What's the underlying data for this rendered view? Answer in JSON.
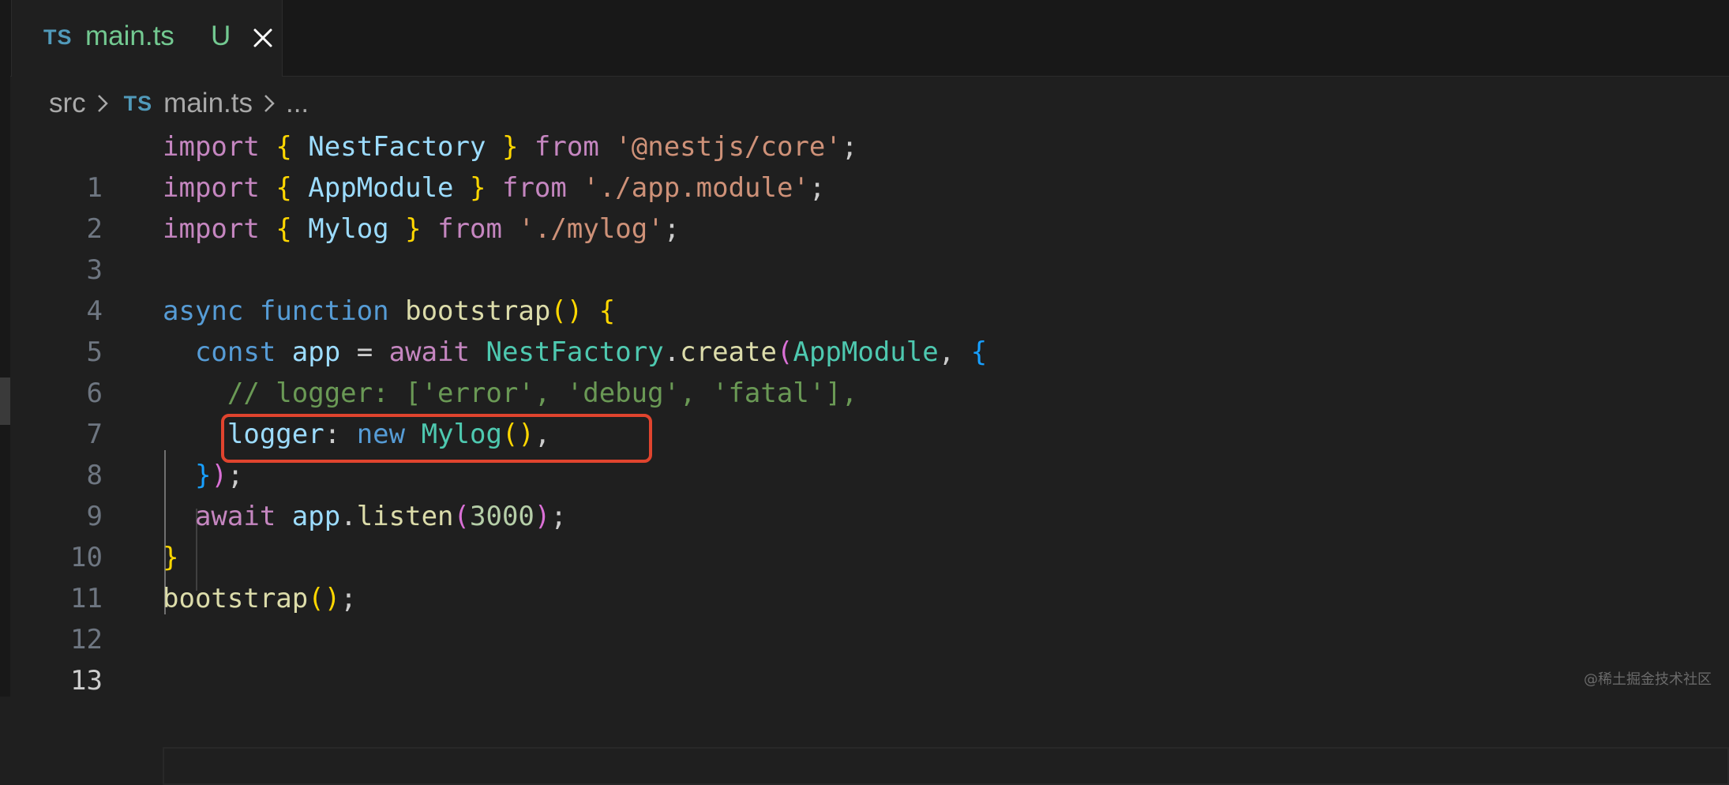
{
  "tab": {
    "file_type": "TS",
    "label": "main.ts",
    "status": "U"
  },
  "breadcrumb": {
    "folder": "src",
    "file_type": "TS",
    "file": "main.ts",
    "more": "..."
  },
  "editor": {
    "active_line": 13,
    "lines": [
      {
        "n": "1"
      },
      {
        "n": "2"
      },
      {
        "n": "3"
      },
      {
        "n": "4"
      },
      {
        "n": "5"
      },
      {
        "n": "6"
      },
      {
        "n": "7"
      },
      {
        "n": "8"
      },
      {
        "n": "9"
      },
      {
        "n": "10"
      },
      {
        "n": "11"
      },
      {
        "n": "12"
      },
      {
        "n": "13"
      }
    ],
    "tokens": {
      "import": "import",
      "from": "from",
      "nestfactory": "NestFactory",
      "appmodule": "AppModule",
      "mylog": "Mylog",
      "str_core": "'@nestjs/core'",
      "str_app_module": "'./app.module'",
      "str_mylog": "'./mylog'",
      "async": "async",
      "function": "function",
      "bootstrap": "bootstrap",
      "const": "const",
      "app": "app",
      "await": "await",
      "create": "create",
      "comment": "// logger: ['error', 'debug', 'fatal'],",
      "logger": "logger",
      "new": "new",
      "listen": "listen",
      "port": "3000"
    }
  },
  "watermark": "@稀土掘金技术社区",
  "colors": {
    "background": "#1f1f1f",
    "tab_text": "#73c991",
    "ts_icon": "#519aba",
    "highlight_box": "#e0442e"
  }
}
